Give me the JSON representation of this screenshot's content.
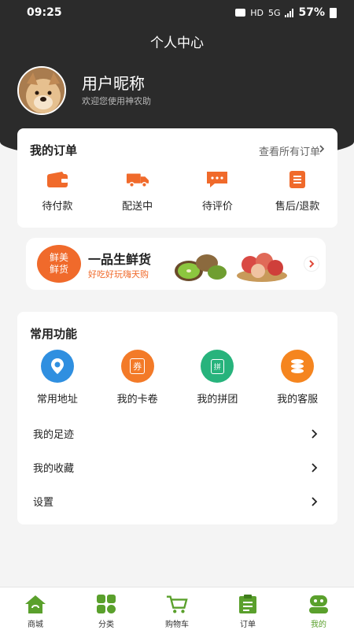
{
  "status_bar": {
    "time": "09:25",
    "network": "HD",
    "signal": "5G",
    "battery": "57%"
  },
  "header": {
    "title": "个人中心"
  },
  "profile": {
    "nickname": "用户昵称",
    "welcome": "欢迎您使用神农助"
  },
  "orders": {
    "title": "我的订单",
    "view_all": "查看所有订单",
    "items": [
      {
        "label": "待付款",
        "icon": "wallet-icon"
      },
      {
        "label": "配送中",
        "icon": "truck-icon"
      },
      {
        "label": "待评价",
        "icon": "comment-icon"
      },
      {
        "label": "售后/退款",
        "icon": "refund-icon"
      }
    ]
  },
  "banner": {
    "badge_line1": "鲜美",
    "badge_line2": "鲜货",
    "title": "一品生鲜货",
    "subtitle": "好吃好玩嗨天购"
  },
  "functions": {
    "title": "常用功能",
    "items": [
      {
        "label": "常用地址",
        "icon": "location-icon",
        "color": "#2f8fe0"
      },
      {
        "label": "我的卡卷",
        "icon": "coupon-icon",
        "glyph": "券",
        "color": "#f37a28"
      },
      {
        "label": "我的拼团",
        "icon": "group-buy-icon",
        "glyph": "拼",
        "color": "#27b37c"
      },
      {
        "label": "我的客服",
        "icon": "service-icon",
        "color": "#f5851f"
      }
    ],
    "list": [
      {
        "label": "我的足迹"
      },
      {
        "label": "我的收藏"
      },
      {
        "label": "设置"
      }
    ]
  },
  "tabbar": {
    "accent": "#5aa02c",
    "items": [
      {
        "label": "商城",
        "icon": "home-icon"
      },
      {
        "label": "分类",
        "icon": "category-icon"
      },
      {
        "label": "购物车",
        "icon": "cart-icon"
      },
      {
        "label": "订单",
        "icon": "order-icon"
      },
      {
        "label": "我的",
        "icon": "profile-icon",
        "active": true
      }
    ]
  }
}
